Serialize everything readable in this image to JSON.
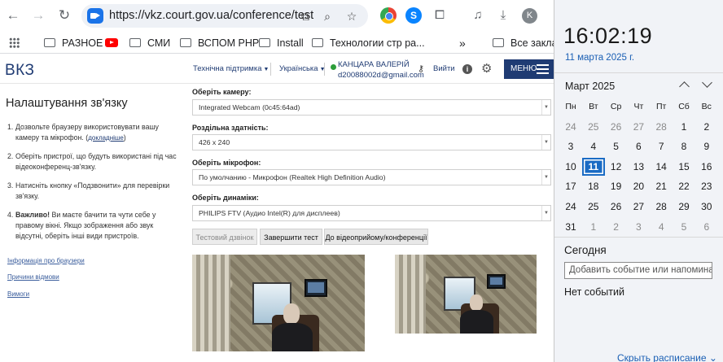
{
  "browser": {
    "url": "https://vkz.court.gov.ua/conference/test",
    "avatar_letter": "K",
    "bookmarks": [
      "РАЗНОЕ",
      "СМИ",
      "ВСПОМ РНР",
      "Install",
      "Технологии стр ра...",
      "»",
      "Все заклад"
    ]
  },
  "site": {
    "logo": "ВКЗ",
    "support": "Технічна підтримка",
    "language": "Українська",
    "user_name": "КАНЦАРА ВАЛЕРІЙ",
    "user_email": "d20088002d@gmail.com",
    "logout": "Вийти",
    "menu": "МЕНЮ"
  },
  "left": {
    "title": "Налаштування зв'язку",
    "step1_text": "Дозвольте браузеру використовувати вашу камеру та мікрофон. (",
    "step1_link": "докладніше",
    "step1_end": ")",
    "step2": "Оберіть пристрої, що будуть використані під час відеоконференц-зв'язку.",
    "step3": "Натисніть кнопку «Подзвонити» для перевірки зв'язку.",
    "step4_bold": "Важливо!",
    "step4_text": " Ви маєте бачити та чути себе у правому вікні. Якщо зображення або звук відсутні, оберіть інші види пристроїв.",
    "links": [
      "Інформація про браузери",
      "Причини відмови",
      "Вимоги"
    ]
  },
  "form": {
    "camera_label": "Оберіть камеру:",
    "camera_value": "Integrated Webcam (0c45:64ad)",
    "resolution_label": "Роздільна здатність:",
    "resolution_value": "426 x 240",
    "mic_label": "Оберіть мікрофон:",
    "mic_value": "По умолчанию - Микрофон (Realtek High Definition Audio)",
    "speakers_label": "Оберіть динаміки:",
    "speakers_value": "PHILIPS FTV (Аудио Intel(R) для дисплеев)",
    "btn_test": "Тестовий дзвінок",
    "btn_end": "Завершити тест",
    "btn_conf": "До відеоприйому/конференції"
  },
  "calendar": {
    "time": "16:02:19",
    "date": "11 марта 2025 г.",
    "month": "Март 2025",
    "weekdays": [
      "Пн",
      "Вт",
      "Ср",
      "Чт",
      "Пт",
      "Сб",
      "Вс"
    ],
    "weeks": [
      [
        "24",
        "25",
        "26",
        "27",
        "28",
        "1",
        "2"
      ],
      [
        "3",
        "4",
        "5",
        "6",
        "7",
        "8",
        "9"
      ],
      [
        "10",
        "11",
        "12",
        "13",
        "14",
        "15",
        "16"
      ],
      [
        "17",
        "18",
        "19",
        "20",
        "21",
        "22",
        "23"
      ],
      [
        "24",
        "25",
        "26",
        "27",
        "28",
        "29",
        "30"
      ],
      [
        "31",
        "1",
        "2",
        "3",
        "4",
        "5",
        "6"
      ]
    ],
    "muted": [
      [
        0,
        0
      ],
      [
        0,
        1
      ],
      [
        0,
        2
      ],
      [
        0,
        3
      ],
      [
        0,
        4
      ],
      [
        5,
        1
      ],
      [
        5,
        2
      ],
      [
        5,
        3
      ],
      [
        5,
        4
      ],
      [
        5,
        5
      ],
      [
        5,
        6
      ]
    ],
    "today": [
      2,
      1
    ],
    "today_label": "Сегодня",
    "event_placeholder": "Добавить событие или напоминание",
    "no_events": "Нет событий",
    "hide_schedule": "Скрыть расписание"
  },
  "colors": {
    "brand": "#1f3b73",
    "today_highlight": "#1a6bc4",
    "link": "#1a5fb4"
  }
}
